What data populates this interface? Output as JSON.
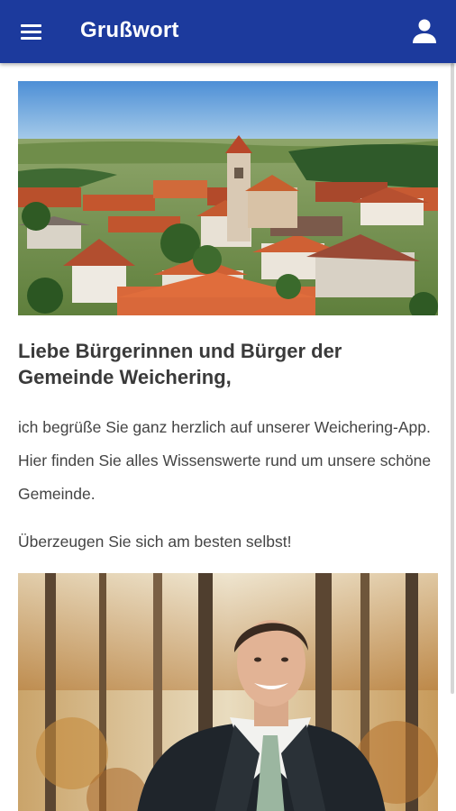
{
  "appbar": {
    "title": "Grußwort",
    "menu_icon": "menu-icon",
    "account_icon": "account-icon",
    "color": "#1c3a9d"
  },
  "article": {
    "headline": "Liebe Bürgerinnen und Bürger der Gemeinde Weichering,",
    "paragraph_1": "ich begrüße Sie ganz herzlich auf unserer Weichering-App. Hier finden Sie alles Wissenswerte rund um unsere schöne Gemeinde.",
    "paragraph_2": "Überzeugen Sie sich am besten selbst!"
  },
  "images": {
    "hero": "aerial-village-photo",
    "portrait": "mayor-portrait-photo"
  }
}
